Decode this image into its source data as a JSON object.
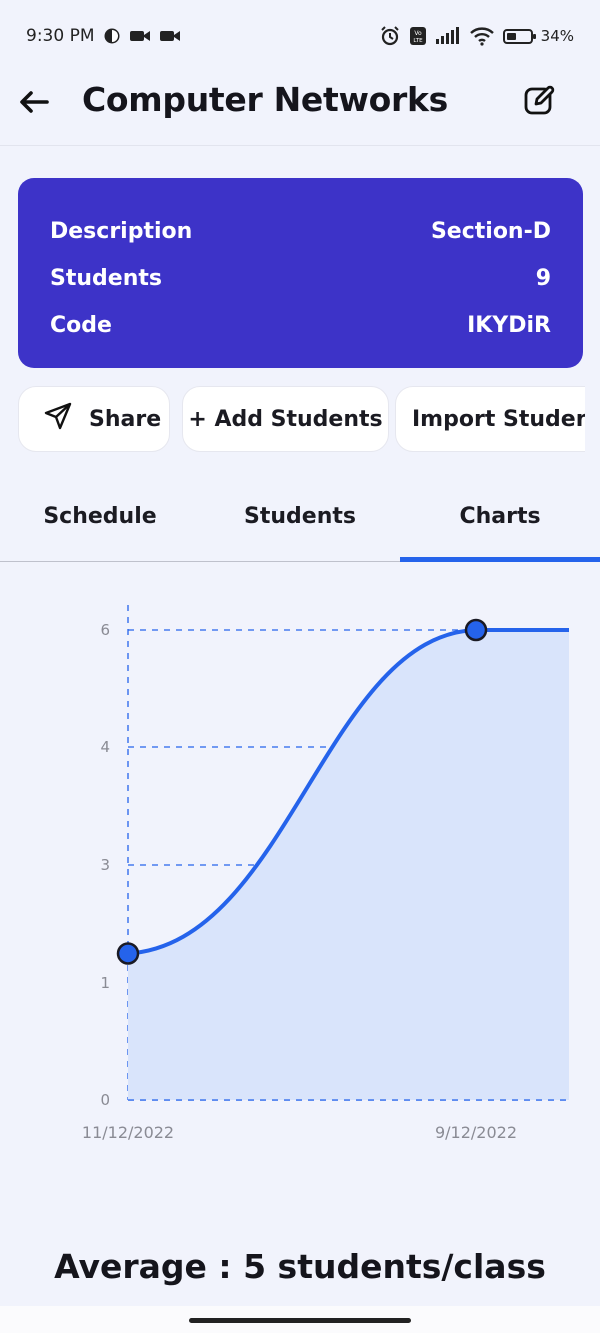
{
  "status_bar": {
    "time": "9:30 PM",
    "battery": "34%",
    "icons": [
      "data-saver-icon",
      "video-camera-icon",
      "video-camera-icon",
      "alarm-icon",
      "volte-icon",
      "signal-icon",
      "wifi-icon",
      "battery-icon"
    ]
  },
  "header": {
    "title": "Computer Networks",
    "back_icon": "arrow-left-icon",
    "edit_icon": "edit-icon"
  },
  "info_card": {
    "rows": [
      {
        "label": "Description",
        "value": "Section-D"
      },
      {
        "label": "Students",
        "value": "9"
      },
      {
        "label": "Code",
        "value": "IKYDiR"
      }
    ],
    "color": "#3d33c8"
  },
  "actions": {
    "share_label": "Share",
    "add_label": "+ Add Students",
    "import_label": "Import Students"
  },
  "tabs": [
    {
      "label": "Schedule",
      "active": false
    },
    {
      "label": "Students",
      "active": false
    },
    {
      "label": "Charts",
      "active": true
    }
  ],
  "accent_color": "#2563eb",
  "chart_data": {
    "type": "area",
    "x": [
      "11/12/2022",
      "9/12/2022"
    ],
    "values": [
      1.5,
      6
    ],
    "y_ticks": [
      "0",
      "1",
      "3",
      "4",
      "6"
    ],
    "x_tick_labels": [
      "11/12/2022",
      "9/12/2022"
    ],
    "grid": true,
    "line_color": "#2563eb",
    "fill_color": "#d9e4fb"
  },
  "average_text": "Average : 5 students/class"
}
